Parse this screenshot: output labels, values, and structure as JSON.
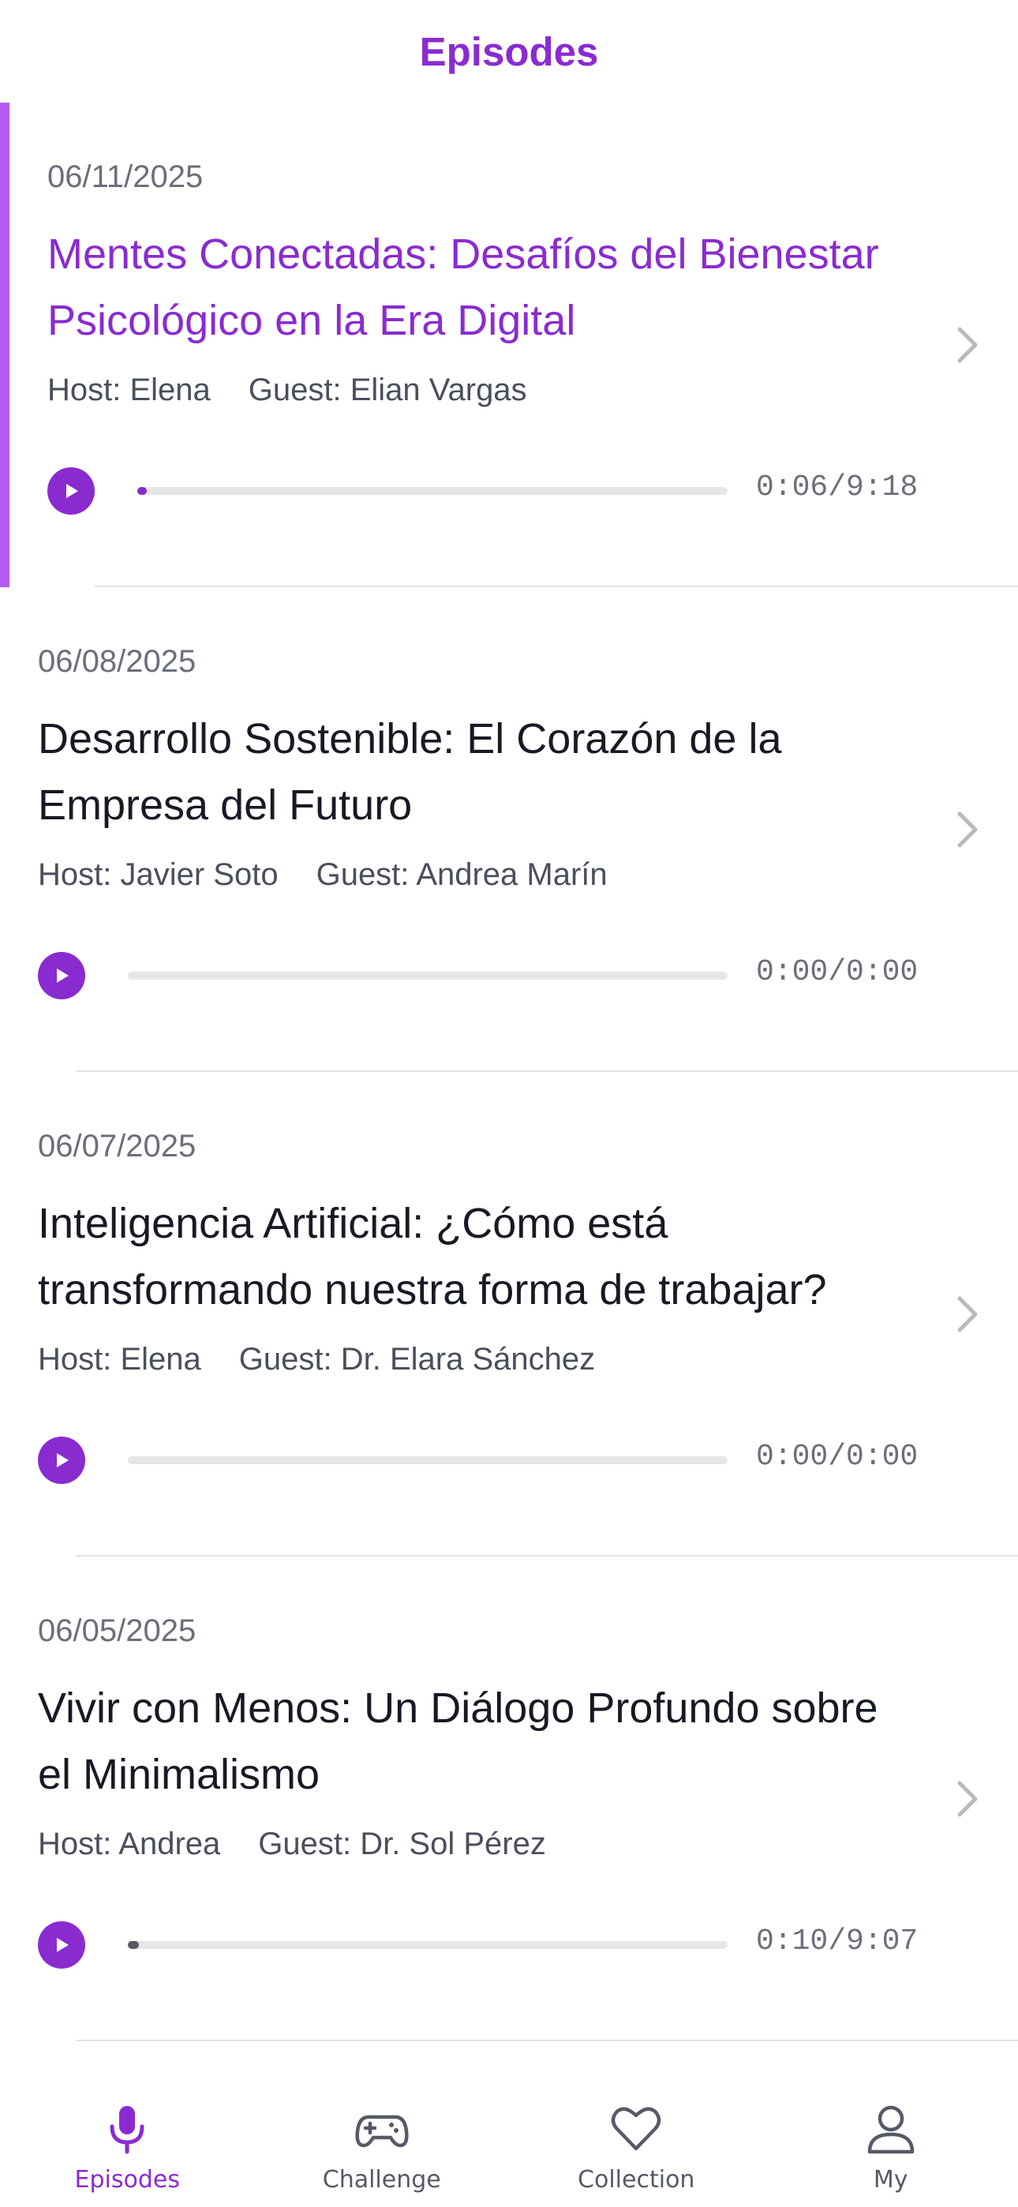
{
  "header": {
    "title": "Episodes"
  },
  "colors": {
    "accent": "#8a2bd0",
    "accent_bar": "#b35cf2",
    "text": "#171a24",
    "muted": "#6b6f7a"
  },
  "episodes": [
    {
      "date": "06/11/2025",
      "title": "Mentes Conectadas: Desafíos del Bienestar Psicológico en la Era Digital",
      "host": "Host: Elena",
      "guest": "Guest: Elian Vargas",
      "time": "0:06/9:18",
      "progress": 0.011,
      "active": true
    },
    {
      "date": "06/08/2025",
      "title": "Desarrollo Sostenible: El Corazón de la Empresa del Futuro",
      "host": "Host: Javier Soto",
      "guest": "Guest: Andrea Marín",
      "time": "0:00/0:00",
      "progress": 0,
      "active": false
    },
    {
      "date": "06/07/2025",
      "title": "Inteligencia Artificial: ¿Cómo está transformando nuestra forma de trabajar?",
      "host": "Host: Elena",
      "guest": "Guest: Dr. Elara Sánchez",
      "time": "0:00/0:00",
      "progress": 0,
      "active": false
    },
    {
      "date": "06/05/2025",
      "title": "Vivir con Menos: Un Diálogo Profundo sobre el Minimalismo",
      "host": "Host: Andrea",
      "guest": "Guest: Dr. Sol Pérez",
      "time": "0:10/9:07",
      "progress": 0.018,
      "active": false
    }
  ],
  "tabs": [
    {
      "label": "Episodes",
      "icon": "microphone-icon",
      "active": true
    },
    {
      "label": "Challenge",
      "icon": "gamepad-icon",
      "active": false
    },
    {
      "label": "Collection",
      "icon": "heart-icon",
      "active": false
    },
    {
      "label": "My",
      "icon": "user-icon",
      "active": false
    }
  ]
}
